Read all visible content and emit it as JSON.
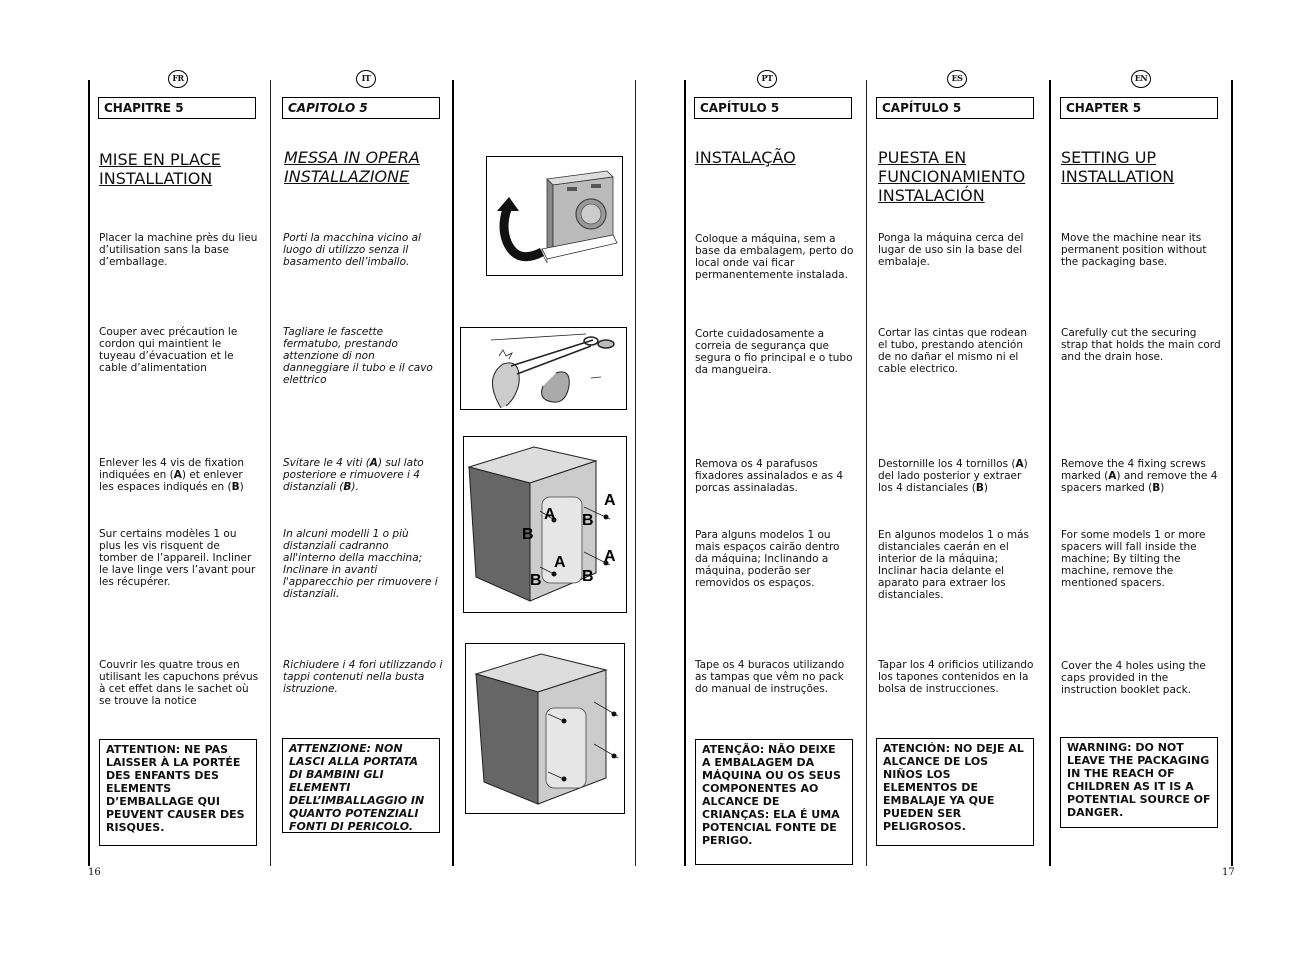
{
  "pages": {
    "left_number": "16",
    "right_number": "17"
  },
  "columns": {
    "fr": {
      "lang_badge": "FR",
      "chapter": "CHAPITRE 5",
      "title": "MISE EN PLACE INSTALLATION",
      "step1": "Placer la machine près du lieu d’utilisation sans la base d’emballage.",
      "step2": "Couper avec précaution le cordon qui maintient le tuyeau d’évacuation et le cable d’alimentation",
      "step3_pre": "Enlever les 4 vis de fixation indiquées en (",
      "step3_a": "A",
      "step3_mid": ") et enlever les espaces indiqués en (",
      "step3_b": "B",
      "step3_post": ")",
      "step4": "Sur certains modèles 1 ou plus les vis risquent de tomber de l’appareil. Incliner le lave linge vers l’avant pour les récupérer.",
      "step5": "Couvrir les quatre trous en utilisant les capuchons prévus à cet effet dans le sachet où se trouve la notice",
      "warning": "ATTENTION: NE PAS LAISSER À LA PORTÉE DES ENFANTS DES ELEMENTS D’EMBALLAGE QUI PEUVENT CAUSER DES RISQUES."
    },
    "it": {
      "lang_badge": "IT",
      "chapter": "CAPITOLO 5",
      "title": "MESSA IN OPERA INSTALLAZIONE",
      "step1": "Porti la macchina vicino al luogo di utilizzo senza il basamento dell’imballo.",
      "step2": "Tagliare le fascette fermatubo, prestando attenzione di non danneggiare il tubo e il cavo elettrico",
      "step3_pre": "Svitare le 4 viti (",
      "step3_a": "A",
      "step3_mid": ") sul lato posteriore e rimuovere i 4 distanziali (",
      "step3_b": "B",
      "step3_post": ").",
      "step4": "In alcuni modelli 1 o più distanziali cadranno all'interno della macchina; Inclinare in avanti l'apparecchio per rimuovere i distanziali.",
      "step5": "Richiudere i 4 fori utilizzando i tappi contenuti nella busta istruzione.",
      "warning": "ATTENZIONE: NON LASCI ALLA PORTATA DI BAMBINI GLI ELEMENTI DELL’IMBALLAGGIO IN QUANTO POTENZIALI FONTI DI PERICOLO."
    },
    "pt": {
      "lang_badge": "PT",
      "chapter": "CAPÍTULO 5",
      "title": "INSTALAÇÃO",
      "step1": "Coloque a máquina, sem a base da embalagem, perto do local onde vai ficar permanentemente instalada.",
      "step2": "Corte cuidadosamente a correia de segurança que segura o fio principal e o tubo da mangueira.",
      "step3": "Remova os 4 parafusos fixadores assinalados e as 4 porcas assinaladas.",
      "step4": "Para alguns modelos 1 ou mais espaços cairão dentro da máquina; Inclinando a máquina, poderão ser removidos os espaços.",
      "step5": "Tape os 4 buracos utilizando as tampas que vêm no pack do manual de instruções.",
      "warning": "ATENÇÃO: NÃO DEIXE A EMBALAGEM DA MÁQUINA OU OS SEUS COMPONENTES AO ALCANCE DE CRIANÇAS: ELA É UMA POTENCIAL FONTE DE PERIGO."
    },
    "es": {
      "lang_badge": "ES",
      "chapter": "CAPÍTULO 5",
      "title": "PUESTA EN FUNCIONAMIENTO INSTALACIÓN",
      "step1": "Ponga la máquina cerca del lugar de uso sin la base del embalaje.",
      "step2": "Cortar las cintas que rodean el tubo, prestando atención de no dañar el mismo ni el cable electrico.",
      "step3_pre": "Destornille los 4 tornillos (",
      "step3_a": "A",
      "step3_mid": ") del lado posterior y extraer los 4 distanciales (",
      "step3_b": "B",
      "step3_post": ")",
      "step4": "En algunos modelos 1 o más distanciales caerán en el interior de la máquina; Inclinar hacia delante el aparato para extraer los distanciales.",
      "step5": "Tapar los 4 orificios utilizando los tapones contenidos en la bolsa de instrucciones.",
      "warning": "ATENCIÓN: NO DEJE AL ALCANCE DE LOS NIÑOS LOS ELEMENTOS DE EMBALAJE YA QUE PUEDEN SER PELIGROSOS."
    },
    "en": {
      "lang_badge": "EN",
      "chapter": "CHAPTER 5",
      "title": "SETTING UP INSTALLATION",
      "step1": "Move the machine near its permanent position without the packaging base.",
      "step2": "Carefully cut the securing strap that holds the main cord and the drain hose.",
      "step3_pre": "Remove the 4 fixing screws marked (",
      "step3_a": "A",
      "step3_mid": ") and remove the 4 spacers marked (",
      "step3_b": "B",
      "step3_post": ")",
      "step4": "For some models 1 or more spacers will fall inside the machine; By tilting the machine, remove the mentioned spacers.",
      "step5": "Cover the 4 holes using the caps provided in the instruction booklet pack.",
      "warning": "WARNING: DO NOT LEAVE THE PACKAGING IN THE REACH OF CHILDREN AS IT IS A POTENTIAL SOURCE OF DANGER."
    }
  },
  "figures": {
    "fig1": {
      "icon": "washing-machine-moved-off-base"
    },
    "fig2": {
      "icon": "scissors-cutting-strap"
    },
    "fig3": {
      "icon": "machine-rear-screws-spacers",
      "labels": [
        "A",
        "A",
        "A",
        "A",
        "B",
        "B",
        "B",
        "B"
      ]
    },
    "fig4": {
      "icon": "machine-rear-holes-caps"
    }
  }
}
